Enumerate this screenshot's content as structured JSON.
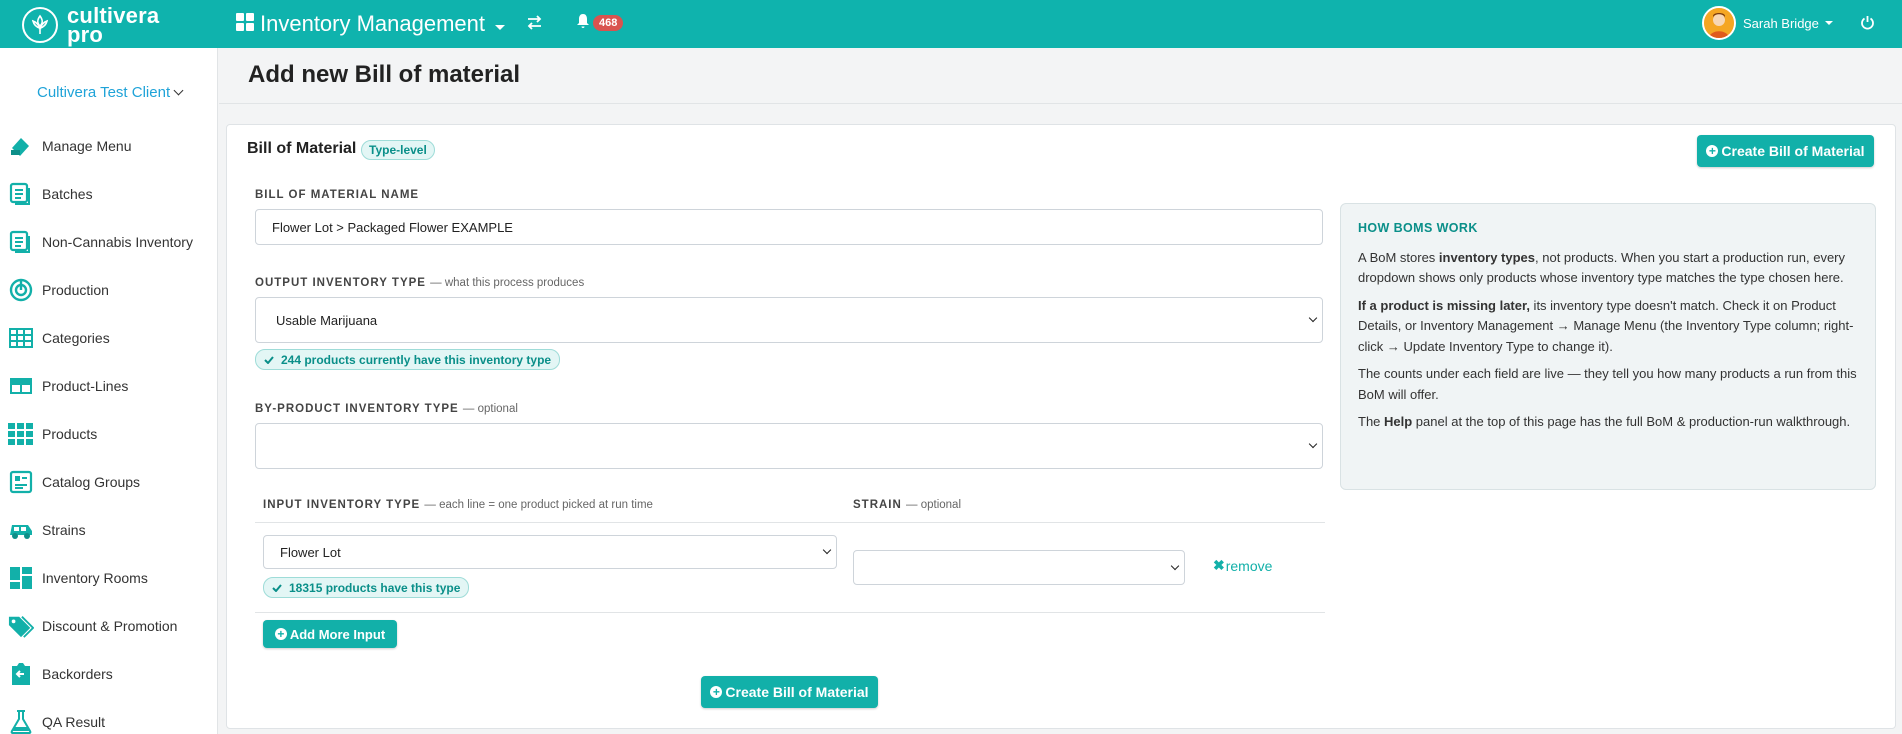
{
  "topbar": {
    "logo_line1": "cultivera",
    "logo_line2": "pro",
    "module_title": "Inventory Management",
    "notification_count": "468",
    "user_name": "Sarah Bridge",
    "colors": {
      "brand": "#0fb3ad",
      "badge": "#d9534f"
    }
  },
  "sidebar": {
    "client": "Cultivera Test Client",
    "items": [
      {
        "label": "Manage Menu",
        "icon": "menu-tag-icon"
      },
      {
        "label": "Batches",
        "icon": "list-icon"
      },
      {
        "label": "Non-Cannabis Inventory",
        "icon": "list-icon"
      },
      {
        "label": "Production",
        "icon": "production-icon"
      },
      {
        "label": "Categories",
        "icon": "table-icon"
      },
      {
        "label": "Product-Lines",
        "icon": "product-lines-icon"
      },
      {
        "label": "Products",
        "icon": "grid-icon"
      },
      {
        "label": "Catalog Groups",
        "icon": "catalog-icon"
      },
      {
        "label": "Strains",
        "icon": "strains-icon"
      },
      {
        "label": "Inventory Rooms",
        "icon": "rooms-icon"
      },
      {
        "label": "Discount & Promotion",
        "icon": "tags-icon"
      },
      {
        "label": "Backorders",
        "icon": "backorders-icon"
      },
      {
        "label": "QA Result",
        "icon": "flask-icon"
      }
    ]
  },
  "page": {
    "title": "Add new Bill of material",
    "card_title": "Bill of Material",
    "type_pill": "Type-level",
    "create_button": "Create Bill of Material"
  },
  "form": {
    "bom_name_label": "BILL OF MATERIAL NAME",
    "bom_name_value": "Flower Lot > Packaged Flower EXAMPLE",
    "output_label": "OUTPUT INVENTORY TYPE",
    "output_hint": "— what this process produces",
    "output_value": "Usable Marijuana",
    "output_count": "244 products currently have this inventory type",
    "byproduct_label": "BY-PRODUCT INVENTORY TYPE",
    "byproduct_hint": "— optional",
    "byproduct_value": "",
    "input_label": "INPUT INVENTORY TYPE",
    "input_hint": "— each line = one product picked at run time",
    "strain_label": "STRAIN",
    "strain_hint": "— optional",
    "input_value": "Flower Lot",
    "input_count": "18315 products have this type",
    "strain_value": "",
    "remove_label": "remove",
    "add_more_label": "Add More Input",
    "submit_label": "Create Bill of Material"
  },
  "help": {
    "heading": "HOW BOMS WORK",
    "p1_a": "A BoM stores ",
    "p1_b": "inventory types",
    "p1_c": ", not products. When you start a production run, every dropdown shows only products whose inventory type matches the type chosen here.",
    "p2_a": "If a product is missing later,",
    "p2_b": " its inventory type doesn't match. Check it on Product Details, or Inventory Management → Manage Menu (the Inventory Type column; right-click → Update Inventory Type to change it).",
    "p3": "The counts under each field are live — they tell you how many products a run from this BoM will offer.",
    "p4_a": "The ",
    "p4_b": "Help",
    "p4_c": " panel at the top of this page has the full BoM & production-run walkthrough."
  }
}
